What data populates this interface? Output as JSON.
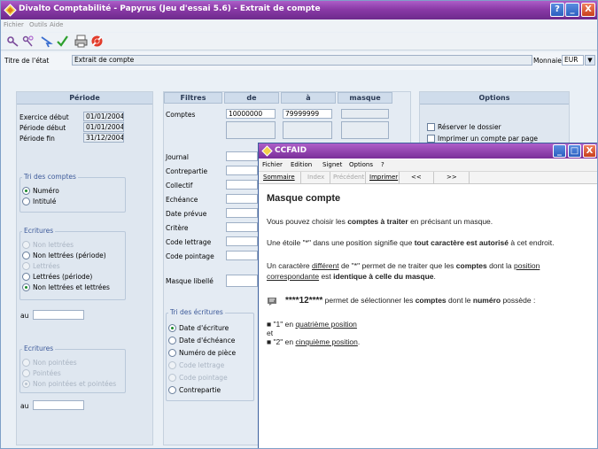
{
  "window": {
    "title": "Divalto Comptabilité - Papyrus (Jeu d'essai 5.6) - Extrait de compte",
    "help_btn": "?",
    "min_btn": "_",
    "max_btn": "□",
    "close_btn": "X"
  },
  "menu": {
    "fichier": "Fichier",
    "outils": "Outils",
    "aide": "Aide"
  },
  "etat": {
    "label": "Titre de l'état",
    "value": "Extrait de compte",
    "monnaie_label": "Monnaie",
    "monnaie_value": "EUR"
  },
  "periode": {
    "header": "Période",
    "exercice_label": "Exercice début",
    "exercice_value": "01/01/2004",
    "debut_label": "Période début",
    "debut_value": "01/01/2004",
    "fin_label": "Période fin",
    "fin_value": "31/12/2004"
  },
  "tri_comptes": {
    "title": "Tri des comptes",
    "numero": "Numéro",
    "intitule": "Intitulé"
  },
  "ecritures1": {
    "title": "Ecritures",
    "non_lettrees": "Non lettrées",
    "non_lettrees_periode": "Non lettrées (période)",
    "lettrees": "Lettrées",
    "lettrees_periode": "Lettrées (période)",
    "non_et_lettrees": "Non lettrées et lettrées",
    "au": "au"
  },
  "ecritures2": {
    "title": "Ecritures",
    "non_pointees": "Non pointées",
    "pointees": "Pointées",
    "non_et_pointees": "Non pointées et pointées",
    "au": "au"
  },
  "filtres": {
    "h_filtres": "Filtres",
    "h_de": "de",
    "h_a": "à",
    "h_masque": "masque",
    "comptes": "Comptes",
    "comptes_de": "10000000",
    "comptes_a": "79999999",
    "journal": "Journal",
    "contrepartie": "Contrepartie",
    "collectif": "Collectif",
    "echeance": "Echéance",
    "date_prevue": "Date prévue",
    "critere": "Critère",
    "code_lettrage": "Code lettrage",
    "code_pointage": "Code pointage",
    "masque_libelle": "Masque libellé"
  },
  "tri_ecritures": {
    "title": "Tri des écritures",
    "date_ecriture": "Date d'écriture",
    "date_echeance": "Date d'échéance",
    "numero_piece": "Numéro de pièce",
    "code_lettrage": "Code lettrage",
    "code_pointage": "Code pointage",
    "contrepartie": "Contrepartie"
  },
  "options": {
    "header": "Options",
    "reserver": "Réserver le dossier",
    "imprimer": "Imprimer un compte par page"
  },
  "popup": {
    "title": "CCFAID",
    "menu": [
      "Fichier",
      "Edition",
      "Signet",
      "Options",
      "?"
    ],
    "nav": {
      "sommaire": "Sommaire",
      "index": "Index",
      "precedent": "Précédent",
      "imprimer": "Imprimer",
      "prev": "<<",
      "next": ">>"
    },
    "heading": "Masque compte",
    "p1a": "Vous pouvez choisir les ",
    "p1b": "comptes à traiter",
    "p1c": " en précisant un masque.",
    "p2a": "Une étoile \"*\" dans une position signifie que ",
    "p2b": "tout caractère est autorisé",
    "p2c": " à cet endroit.",
    "p3a": "Un caractère ",
    "p3b": "différent",
    "p3c": " de \"*\" permet de ne traiter que les ",
    "p3d": "comptes",
    "p3e": " dont la ",
    "p3f": "position",
    "p3g": "correspondante",
    "p3h": " est ",
    "p3i": "identique à celle du masque",
    "p3j": ".",
    "ex_mask": "****12****",
    "ex_a": " permet de sélectionner les ",
    "ex_b": "comptes",
    "ex_c": " dont le ",
    "ex_d": "numéro",
    "ex_e": " possède :",
    "b1a": "\"1\" en ",
    "b1b": "quatrième position",
    "et": "et",
    "b2a": "\"2\" en ",
    "b2b": "cinquième position",
    "b2c": "."
  },
  "colors": {
    "titlebar": "#8a3aa7",
    "panel": "#dfe7f0",
    "accent": "#3d5a9a"
  }
}
